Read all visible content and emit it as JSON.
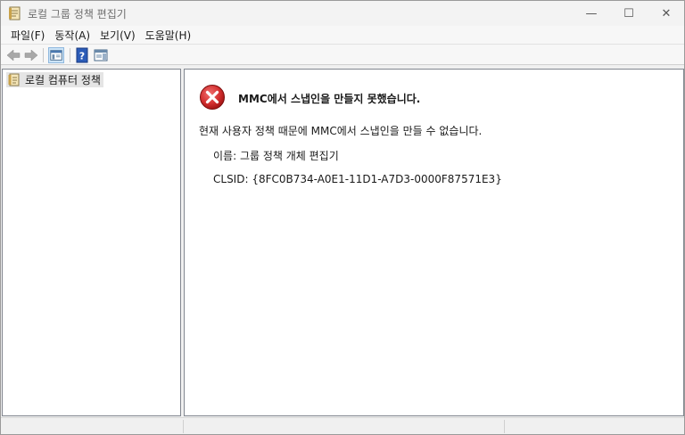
{
  "window": {
    "title": "로컬 그룹 정책 편집기",
    "minimize_glyph": "—",
    "maximize_glyph": "☐",
    "close_glyph": "✕"
  },
  "menu": {
    "items": [
      {
        "label": "파일(F)"
      },
      {
        "label": "동작(A)"
      },
      {
        "label": "보기(V)"
      },
      {
        "label": "도움말(H)"
      }
    ]
  },
  "toolbar": {
    "icons": [
      "back-arrow-icon",
      "forward-arrow-icon",
      "show-hide-console-tree-icon",
      "help-icon",
      "show-hide-action-pane-icon"
    ]
  },
  "tree": {
    "root_label": "로컬 컴퓨터 정책"
  },
  "error": {
    "title": "MMC에서 스냅인을 만들지 못했습니다.",
    "description": "현재 사용자 정책 때문에 MMC에서 스냅인을 만들 수 없습니다.",
    "name_line": "이름: 그룹 정책 개체 편집기",
    "clsid_line": "CLSID: {8FC0B734-A0E1-11D1-A7D3-0000F87571E3}"
  },
  "colors": {
    "error_red": "#d32f2f",
    "pane_border": "#828790",
    "help_blue": "#2b5cb8"
  }
}
